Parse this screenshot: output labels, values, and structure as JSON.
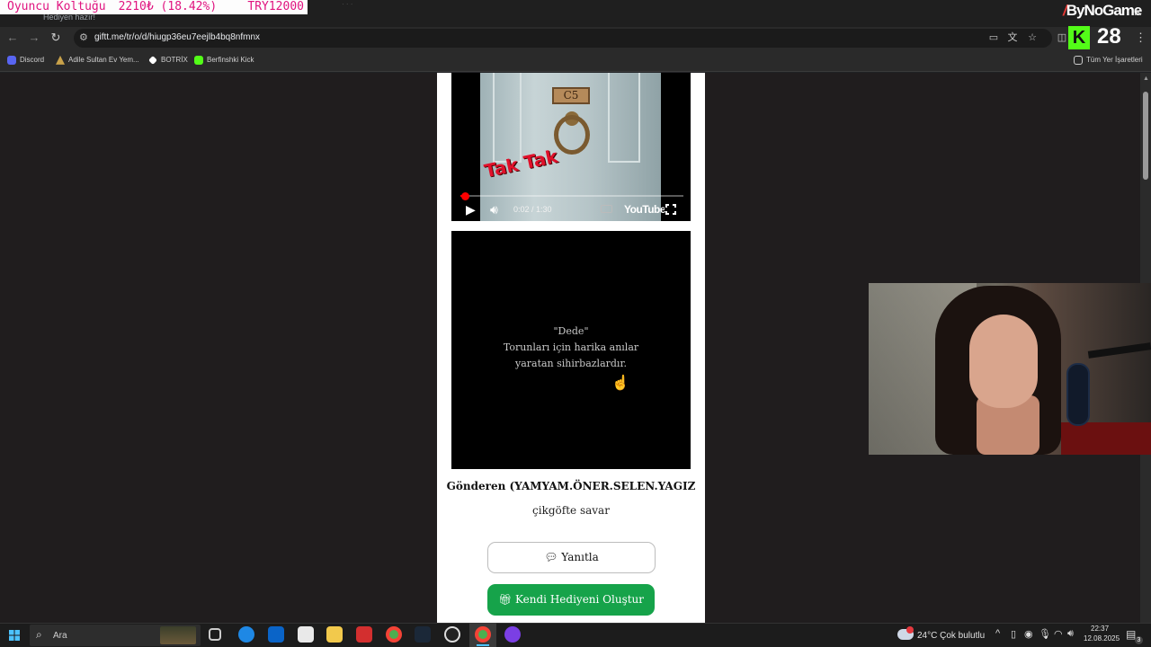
{
  "overlay": {
    "label": "Oyuncu Koltuğu",
    "amount": "2210₺ (18.42%)",
    "target": "TRY12000"
  },
  "browser": {
    "tab_title": "Hediyen hazır!",
    "url": "giftt.me/tr/o/d/hiugp36eu7eejlb4bq8nfmnx",
    "brand": "ByNoGame",
    "kick_count": "28",
    "bookmarks": [
      "Discord",
      "Adile Sultan Ev Yem...",
      "BOTRİX",
      "Berfinshki Kick"
    ],
    "all_bookmarks": "Tüm Yer İşaretleri"
  },
  "video": {
    "plate": "C5",
    "overlay_text": "Tak Tak",
    "time": "0:02 / 1:30",
    "progress": 0.022,
    "logo": "YouTube"
  },
  "poem": {
    "title": "\"Dede\"",
    "line1": "Torunları için harika anılar",
    "line2": "yaratan sihirbazlardır."
  },
  "gift": {
    "sender": "Gönderen (YAMYAM.ÖNER.SELEN.YAGIZ",
    "message": "çikgöfte savar",
    "reply_label": "Yanıtla",
    "create_label": "Kendi Hediyeni Oluştur"
  },
  "taskbar": {
    "search": "Ara",
    "weather": "24°C  Çok bulutlu",
    "time": "22:37",
    "date": "12.08.2025",
    "notifications": "3"
  },
  "colors": {
    "accent_green": "#16a34a",
    "kick_green": "#53fc18",
    "youtube_red": "#ff0000"
  }
}
